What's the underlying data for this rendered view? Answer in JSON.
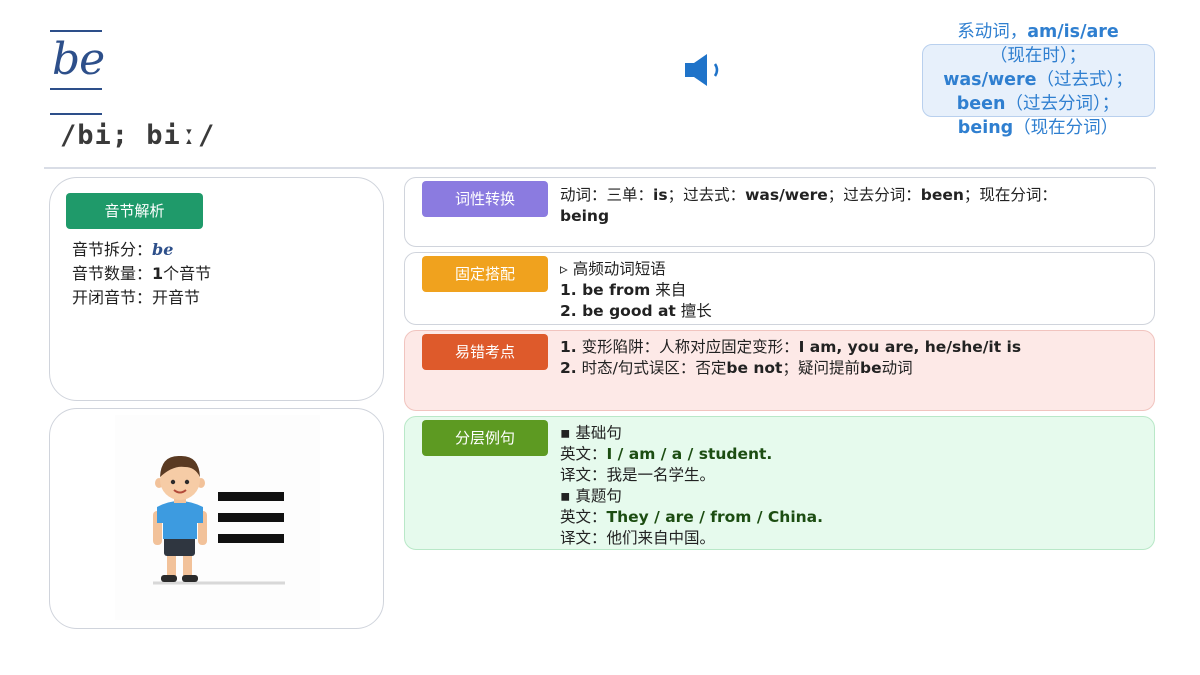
{
  "header": {
    "word": "be",
    "phonetic": "/bi; biː/",
    "meaning_lines": [
      {
        "pre": "系动词，",
        "bold": "am/is/are",
        "post": ""
      },
      {
        "pre": "（现在时）；",
        "bold": "",
        "post": ""
      },
      {
        "pre": "",
        "bold": "was/were",
        "post": "（过去式）；"
      },
      {
        "pre": "",
        "bold": "been",
        "post": "（过去分词）；"
      },
      {
        "pre": "",
        "bold": "being",
        "post": "（现在分词）"
      }
    ]
  },
  "syllable": {
    "tag": "音节解析",
    "split_label": "音节拆分：",
    "split_value": "be",
    "count_label": "音节数量：",
    "count_value": "1",
    "count_unit": "个音节",
    "open_label": "开闭音节：",
    "open_value": "开音节"
  },
  "pos": {
    "tag": "词性转换",
    "t1": "动词：三单：",
    "v1": "is",
    "t2": "；过去式：",
    "v2": "was/were",
    "t3": "；过去分词：",
    "v3": "been",
    "t4": "；现在分词：",
    "v4": "being"
  },
  "fixed": {
    "tag": "固定搭配",
    "heading": "▹  高频动词短语",
    "items": [
      {
        "en": "1. be from",
        "zh": " 来自"
      },
      {
        "en": "2. be good at",
        "zh": " 擅长"
      }
    ]
  },
  "errors": {
    "tag": "易错考点",
    "l1_num": "1.",
    "l1_text": " 变形陷阱：人称对应固定变形：",
    "l1_bold": "I am, you are, he/she/it is",
    "l2_num": "2.",
    "l2_a": " 时态/句式误区：否定",
    "l2_b": "be not",
    "l2_c": "；疑问提前",
    "l2_d": "be",
    "l2_e": "动词"
  },
  "examples": {
    "tag": "分层例句",
    "basic_heading": "▪ 基础句",
    "basic_en_label": "英文：",
    "basic_en": "I / am / a / student.",
    "basic_zh_label": "译文：",
    "basic_zh": "我是一名学生。",
    "real_heading": "▪ 真题句",
    "real_en_label": "英文：",
    "real_en": "They / are / from / China.",
    "real_zh_label": "译文：",
    "real_zh": "他们来自中国。"
  },
  "colors": {
    "word": "#2d4f8a",
    "meaning": "#2f7fd0",
    "syllable_tag": "#1f9a6a",
    "pos_tag": "#8b7be0",
    "fixed_tag": "#f0a21e",
    "error_tag": "#de5a2b",
    "example_tag": "#5d9a22"
  },
  "icons": [
    "speaker-icon",
    "boy-illustration",
    "menu-lines-icon"
  ]
}
